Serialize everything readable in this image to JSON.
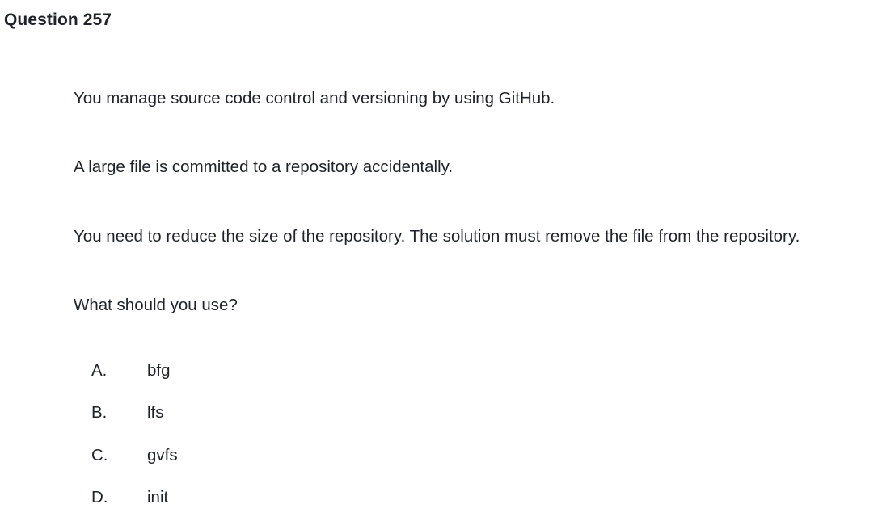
{
  "question": {
    "title": "Question 257",
    "paragraphs": [
      "You manage source code control and versioning by using GitHub.",
      "A large file is committed to a repository accidentally.",
      "You need to reduce the size of the repository. The solution must remove the file from the repository.",
      "What should you use?"
    ],
    "options": [
      {
        "letter": "A.",
        "text": "bfg"
      },
      {
        "letter": "B.",
        "text": "lfs"
      },
      {
        "letter": "C.",
        "text": "gvfs"
      },
      {
        "letter": "D.",
        "text": "init"
      }
    ]
  }
}
